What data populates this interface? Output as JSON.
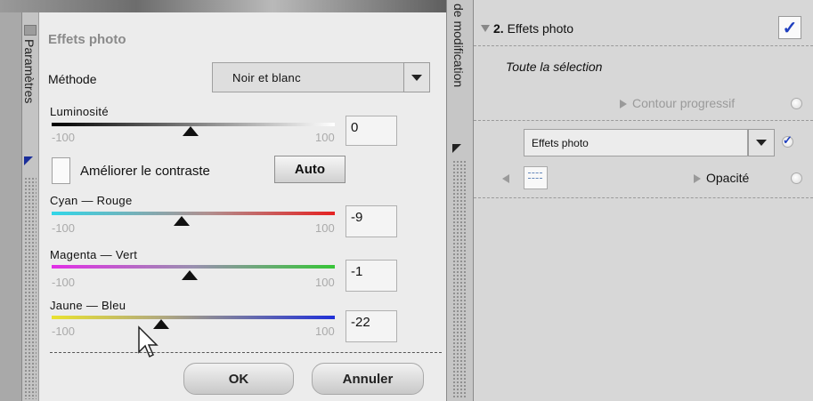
{
  "left_tab": {
    "label": "Paramètres"
  },
  "dialog": {
    "title": "Effets photo",
    "method": {
      "label": "Méthode",
      "value": "Noir et blanc"
    },
    "luminosity": {
      "label": "Luminosité",
      "min": "-100",
      "max": "100",
      "value": "0"
    },
    "enhance_contrast": {
      "label": "Améliorer le contraste",
      "checked": false,
      "auto_label": "Auto"
    },
    "sliders": [
      {
        "label": "Cyan — Rouge",
        "min": "-100",
        "max": "100",
        "value": "-9",
        "colors": [
          "#31d6e8",
          "#e52222"
        ]
      },
      {
        "label": "Magenta — Vert",
        "min": "-100",
        "max": "100",
        "value": "-1",
        "colors": [
          "#e22ee6",
          "#37c537"
        ]
      },
      {
        "label": "Jaune — Bleu",
        "min": "-100",
        "max": "100",
        "value": "-22",
        "colors": [
          "#e9e230",
          "#2030d8"
        ]
      }
    ],
    "ok_label": "OK",
    "cancel_label": "Annuler"
  },
  "mid_tab": {
    "label": "de modification"
  },
  "right_panel": {
    "step_number": "2.",
    "step_title": "Effets photo",
    "step_checked": true,
    "scope": "Toute la sélection",
    "feather_label": "Contour progressif",
    "effect_select": "Effets photo",
    "opacity_label": "Opacité"
  }
}
